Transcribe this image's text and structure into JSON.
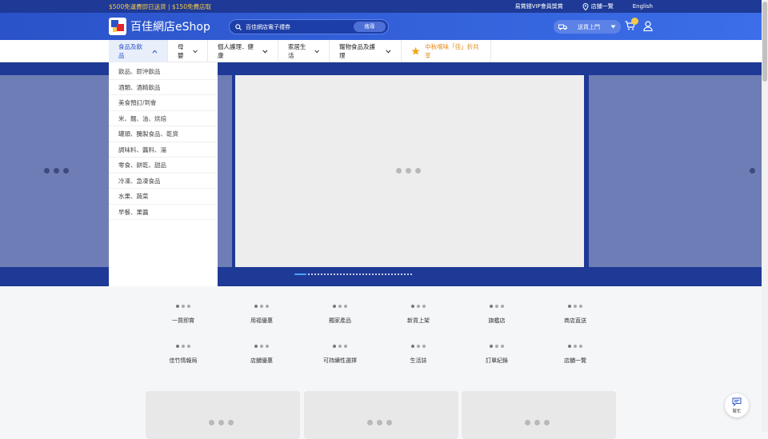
{
  "topbar": {
    "promo": "$500免運費即日送貨 | $150免費店取",
    "vip": "易賞錢VIP會員獎賞",
    "stores": "店舖一覽",
    "language": "English"
  },
  "header": {
    "logo_text": "百佳網店eShop",
    "search_placeholder": "百佳網店電子禮券",
    "search_button": "搜尋",
    "delivery_label": "送貨上門",
    "cart_count": ""
  },
  "nav": {
    "items": [
      {
        "label": "食品及飲品"
      },
      {
        "label": "母嬰"
      },
      {
        "label": "個人護理．健康"
      },
      {
        "label": "家居生活"
      },
      {
        "label": "寵物食品及護理"
      },
      {
        "label": "中秋嚐味「佳」折共享"
      }
    ]
  },
  "dropdown": {
    "items": [
      "飲品、即沖飲品",
      "酒類、酒精飲品",
      "美食預訂/到會",
      "米、麵、油、烘焙",
      "罐頭、醃製食品、乾貨",
      "調味料、醬料、湯",
      "零食、餅乾、甜品",
      "冷凍、急凍食品",
      "水果、蔬菜",
      "早餐、果醬"
    ]
  },
  "quick_links": [
    "一買即賞",
    "用福優惠",
    "獨家產品",
    "新貨上架",
    "旗艦店",
    "商店直送",
    "佳竹情報局",
    "店舖優惠",
    "可持續性選擇",
    "生活誌",
    "訂單紀錄",
    "店舖一覽"
  ],
  "help": {
    "label": "幫忙"
  },
  "colors": {
    "brand_blue": "#2a52c9",
    "dark_blue": "#1e3a96",
    "promo_yellow": "#f7c948",
    "promo_orange": "#e48a1b"
  }
}
